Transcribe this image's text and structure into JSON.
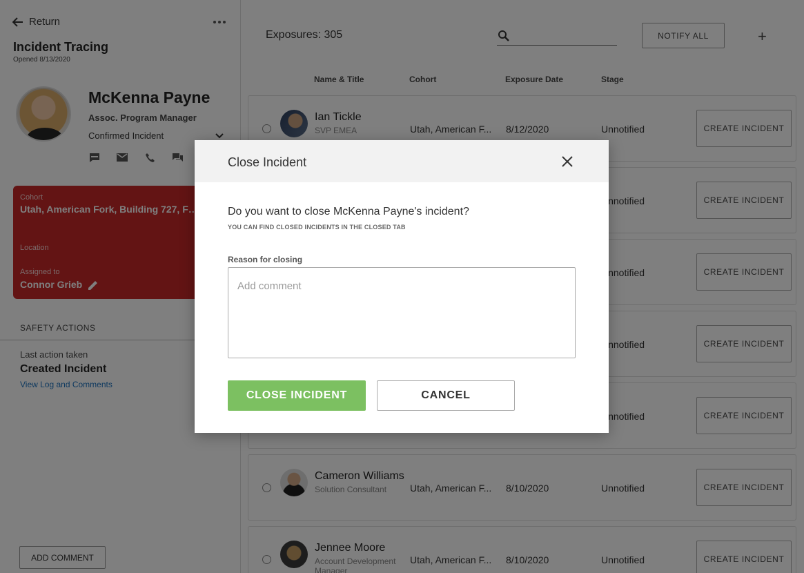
{
  "left": {
    "return_label": "Return",
    "title": "Incident Tracing",
    "opened": "Opened 8/13/2020",
    "person": {
      "name": "McKenna Payne",
      "job_title": "Assoc. Program Manager",
      "status": "Confirmed Incident"
    },
    "card": {
      "cohort_label": "Cohort",
      "cohort_value": "Utah, American Fork, Building 727, F… 3",
      "location_label": "Location",
      "assigned_label": "Assigned to",
      "assigned_value": "Connor Grieb",
      "color": "#c62828"
    },
    "safety_actions": "SAFETY ACTIONS",
    "last_action_label": "Last action taken",
    "last_action": "Created Incident",
    "view_log": "View Log and Comments",
    "add_comment": "ADD COMMENT"
  },
  "right": {
    "exposures": "Exposures: 305",
    "search_placeholder": "",
    "notify_all": "NOTIFY ALL",
    "add_label": "+",
    "columns": [
      "Name & Title",
      "Cohort",
      "Exposure Date",
      "Stage"
    ],
    "rows": [
      {
        "name": "Ian Tickle",
        "title": "SVP EMEA",
        "cohort": "Utah, American F...",
        "date": "8/12/2020",
        "stage": "Unnotified",
        "button": "CREATE INCIDENT"
      },
      {
        "name": "",
        "title": "",
        "cohort": "",
        "date": "",
        "stage": "Unnotified",
        "button": "CREATE INCIDENT"
      },
      {
        "name": "",
        "title": "",
        "cohort": "",
        "date": "",
        "stage": "Unnotified",
        "button": "CREATE INCIDENT"
      },
      {
        "name": "",
        "title": "",
        "cohort": "",
        "date": "",
        "stage": "Unnotified",
        "button": "CREATE INCIDENT"
      },
      {
        "name": "",
        "title": "",
        "cohort": "",
        "date": "",
        "stage": "Unnotified",
        "button": "CREATE INCIDENT"
      },
      {
        "name": "Cameron Williams",
        "title": "Solution Consultant",
        "cohort": "Utah, American F...",
        "date": "8/10/2020",
        "stage": "Unnotified",
        "button": "CREATE INCIDENT"
      },
      {
        "name": "Jennee Moore",
        "title": "Account Development Manager",
        "cohort": "Utah, American F...",
        "date": "8/10/2020",
        "stage": "Unnotified",
        "button": "CREATE INCIDENT"
      }
    ]
  },
  "modal": {
    "title": "Close Incident",
    "question": "Do you want to close McKenna Payne's incident?",
    "hint": "YOU CAN FIND CLOSED INCIDENTS IN THE CLOSED TAB",
    "reason_label": "Reason for closing",
    "reason_placeholder": "Add comment",
    "confirm": "CLOSE INCIDENT",
    "cancel": "CANCEL",
    "confirm_color": "#7cc061"
  }
}
